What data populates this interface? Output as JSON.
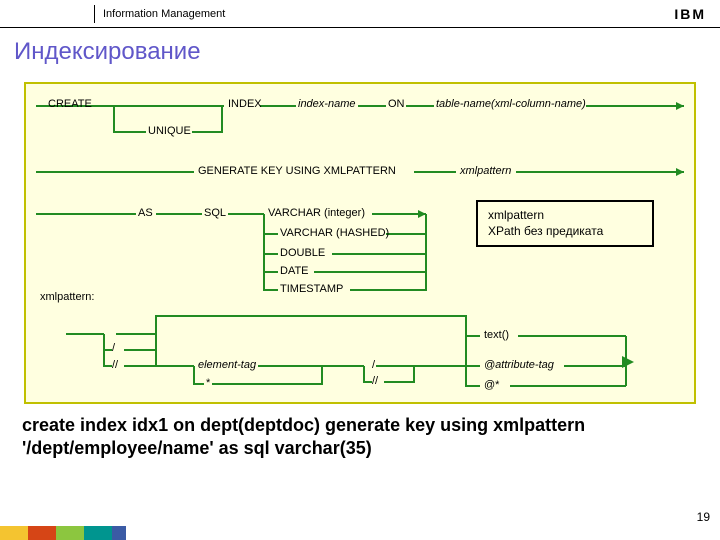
{
  "header": {
    "section": "Information Management",
    "logo": "IBM"
  },
  "title": "Индексирование",
  "diagram": {
    "kw_create": "CREATE",
    "kw_index": "INDEX",
    "lbl_index_name": "index-name",
    "kw_on": "ON",
    "lbl_table_col": "table-name(xml-column-name)",
    "kw_unique": "UNIQUE",
    "kw_generate": "GENERATE KEY USING XMLPATTERN",
    "lbl_xmlpattern": "xmlpattern",
    "kw_as": "AS",
    "kw_sql": "SQL",
    "types": {
      "varchar_int": "VARCHAR (integer)",
      "varchar_hashed": "VARCHAR (HASHED)",
      "double": "DOUBLE",
      "date": "DATE",
      "timestamp": "TIMESTAMP"
    },
    "note": {
      "line1": "xmlpattern",
      "line2": "XPath без предиката"
    },
    "xp_label": "xmlpattern:",
    "slash": "/",
    "dslash": "//",
    "elem_tag": "element-tag",
    "star": "*",
    "text_fn": "text()",
    "attr_tag": "@attribute-tag",
    "at_star": "@*"
  },
  "sql_example": "create index idx1 on dept(deptdoc) generate key using xmlpattern '/dept/employee/name' as sql varchar(35)",
  "page_number": "19"
}
